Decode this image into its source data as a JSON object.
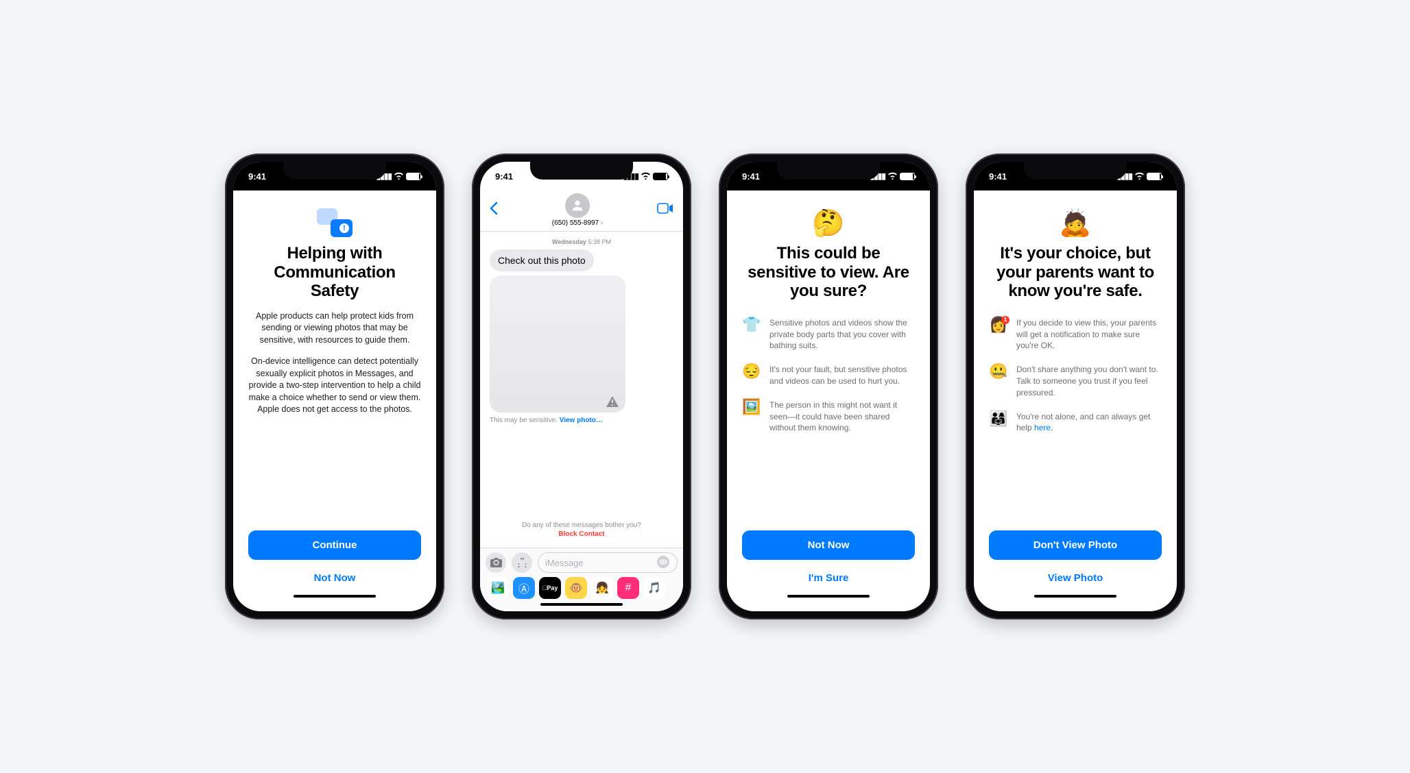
{
  "status": {
    "time": "9:41"
  },
  "screen1": {
    "title": "Helping with Communication Safety",
    "body1": "Apple products can help protect kids from sending or viewing photos that may be sensitive, with resources to guide them.",
    "body2": "On-device intelligence can detect potentially sexually explicit photos in Messages, and provide a two-step intervention to help a child make a choice whether to send or view them. Apple does not get access to the photos.",
    "primary": "Continue",
    "secondary": "Not Now"
  },
  "screen2": {
    "phone_number": "(650) 555-8997",
    "day": "Wednesday",
    "time": "5:38 PM",
    "message": "Check out this photo",
    "sensitive_label": "This may be sensitive.",
    "view_link": "View photo…",
    "report_question": "Do any of these messages bother you?",
    "block_link": "Block Contact",
    "compose_placeholder": "iMessage"
  },
  "screen3": {
    "emoji": "🤔",
    "title": "This could be sensitive to view. Are you sure?",
    "bullets": [
      {
        "icon": "👕",
        "text": "Sensitive photos and videos show the private body parts that you cover with bathing suits."
      },
      {
        "icon": "😔",
        "text": "It's not your fault, but sensitive photos and videos can be used to hurt you."
      },
      {
        "icon": "🖼️",
        "text": "The person in this might not want it seen—it could have been shared without them knowing."
      }
    ],
    "primary": "Not Now",
    "secondary": "I'm Sure"
  },
  "screen4": {
    "emoji": "🙇",
    "title": "It's your choice, but your parents want to know you're safe.",
    "bullets": [
      {
        "icon": "👩",
        "text": "If you decide to view this, your parents will get a notification to make sure you're OK."
      },
      {
        "icon": "🤐",
        "text": "Don't share anything you don't want to. Talk to someone you trust if you feel pressured."
      },
      {
        "icon": "👨‍👩‍👧",
        "text": "You're not alone, and can always get help ",
        "link": "here."
      }
    ],
    "primary": "Don't View Photo",
    "secondary": "View Photo"
  }
}
